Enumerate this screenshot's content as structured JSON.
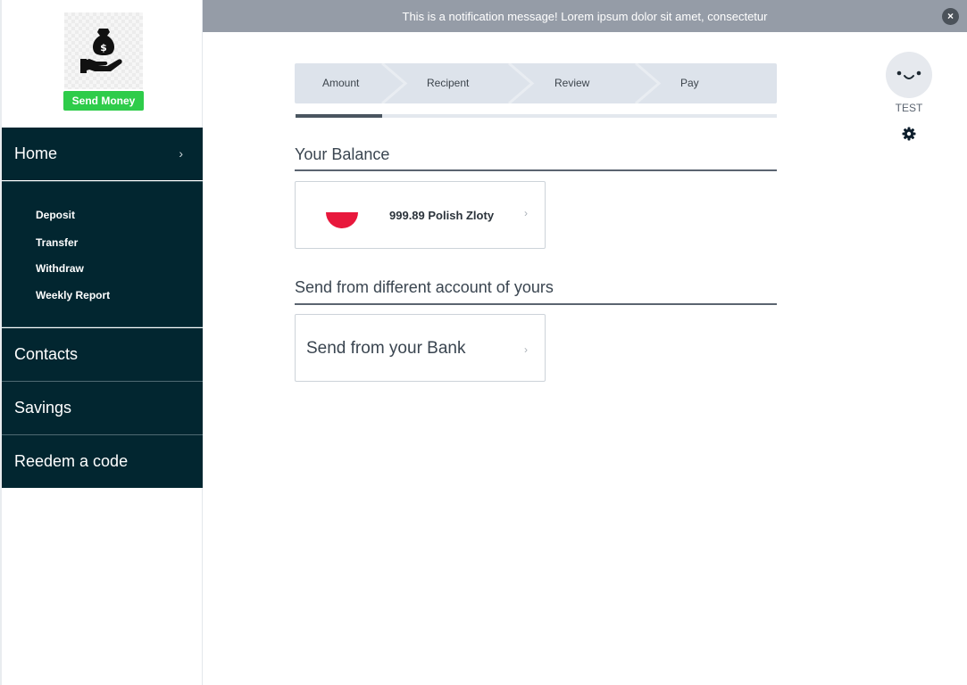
{
  "sidebar": {
    "logo_icon": "money-bag-hand-icon",
    "send_money_label": "Send Money",
    "home": {
      "label": "Home",
      "chevron": "›"
    },
    "home_submenu": [
      {
        "label": "Deposit"
      },
      {
        "label": "Transfer"
      },
      {
        "label": "Withdraw"
      },
      {
        "label": "Weekly Report"
      }
    ],
    "items": [
      {
        "label": "Contacts"
      },
      {
        "label": "Savings"
      },
      {
        "label": "Reedem a code"
      }
    ]
  },
  "notification": {
    "message": "This is a notification message! Lorem ipsum dolor sit amet, consectetur",
    "close_glyph": "×"
  },
  "stepper": {
    "steps": [
      "Amount",
      "Recipent",
      "Review",
      "Pay"
    ],
    "active_index": 0,
    "progress_fraction": 0.18
  },
  "balance": {
    "title": "Your Balance",
    "amount_text": "999.89 Polish Zloty",
    "chevron": "›"
  },
  "other_account": {
    "title": "Send from different account of yours",
    "bank_label": "Send from your Bank",
    "chevron": "›"
  },
  "user": {
    "name": "TEST",
    "settings_icon": "gear-icon"
  },
  "colors": {
    "sidebar_bg": "#022630",
    "accent_green": "#2ecc4a",
    "notification_bg": "#959ca7",
    "stepper_bg": "#dde3eb",
    "flag_red": "#e8183c"
  }
}
